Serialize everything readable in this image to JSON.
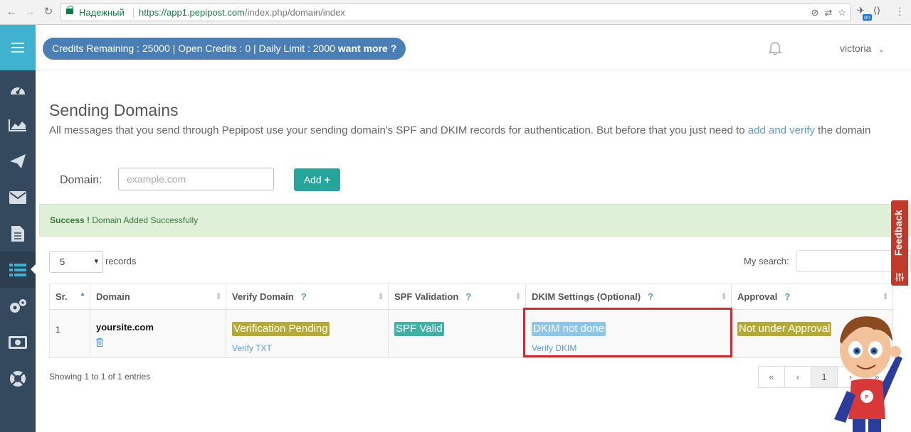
{
  "browser": {
    "secure_label": "Надежный",
    "url_host": "https://app1.pepipost.com",
    "url_path": "/index.php/domain/index",
    "ext_badge": "on"
  },
  "header": {
    "credits_text": "Credits Remaining : 25000 | Open Credits : 0 | Daily Limit : 2000 ",
    "want_more": "want more ?",
    "username": "victoria"
  },
  "page": {
    "title": "Sending Domains",
    "description": "All messages that you send through Pepipost use your sending domain's SPF and DKIM records for authentication. But before that you just need to ",
    "description_link": "add and verify",
    "description_end": " the domain"
  },
  "form": {
    "domain_label": "Domain:",
    "domain_placeholder": "example.com",
    "add_label": "Add"
  },
  "alert": {
    "strong": "Success !",
    "message": " Domain Added Successfully",
    "close": "×"
  },
  "table_controls": {
    "length_value": "5",
    "records_label": "records",
    "search_label": "My search:"
  },
  "table": {
    "columns": [
      "Sr.",
      "Domain",
      "Verify Domain",
      "SPF Validation",
      "DKIM Settings (Optional)",
      "Approval"
    ],
    "help_mark": "?",
    "rows": [
      {
        "sr": "1",
        "domain": "yoursite.com",
        "verify_status": "Verification Pending",
        "verify_link": "Verify TXT",
        "spf_status": "SPF Valid",
        "dkim_status": "DKIM not done",
        "dkim_link": "Verify DKIM",
        "approval_status": "Not under Approval"
      }
    ]
  },
  "footer": {
    "info": "Showing 1 to 1 of 1 entries",
    "pager": [
      "«",
      "‹",
      "1",
      "›",
      "»"
    ]
  },
  "feedback_label": "Feedback",
  "colors": {
    "sidebar": "#34495e",
    "sidebar_top": "#3fb2cf",
    "credits_pill": "#4a7fb5",
    "add_button": "#26a69a",
    "badge_pending": "#b5aa35",
    "badge_valid": "#3fb2a6",
    "badge_dkim": "#8cc7eb",
    "highlight": "#d9252b"
  },
  "sidebar_icons": [
    "dashboard-icon",
    "chart-icon",
    "send-icon",
    "mail-icon",
    "file-icon",
    "list-icon",
    "settings-icon",
    "money-icon",
    "lifebuoy-icon"
  ]
}
